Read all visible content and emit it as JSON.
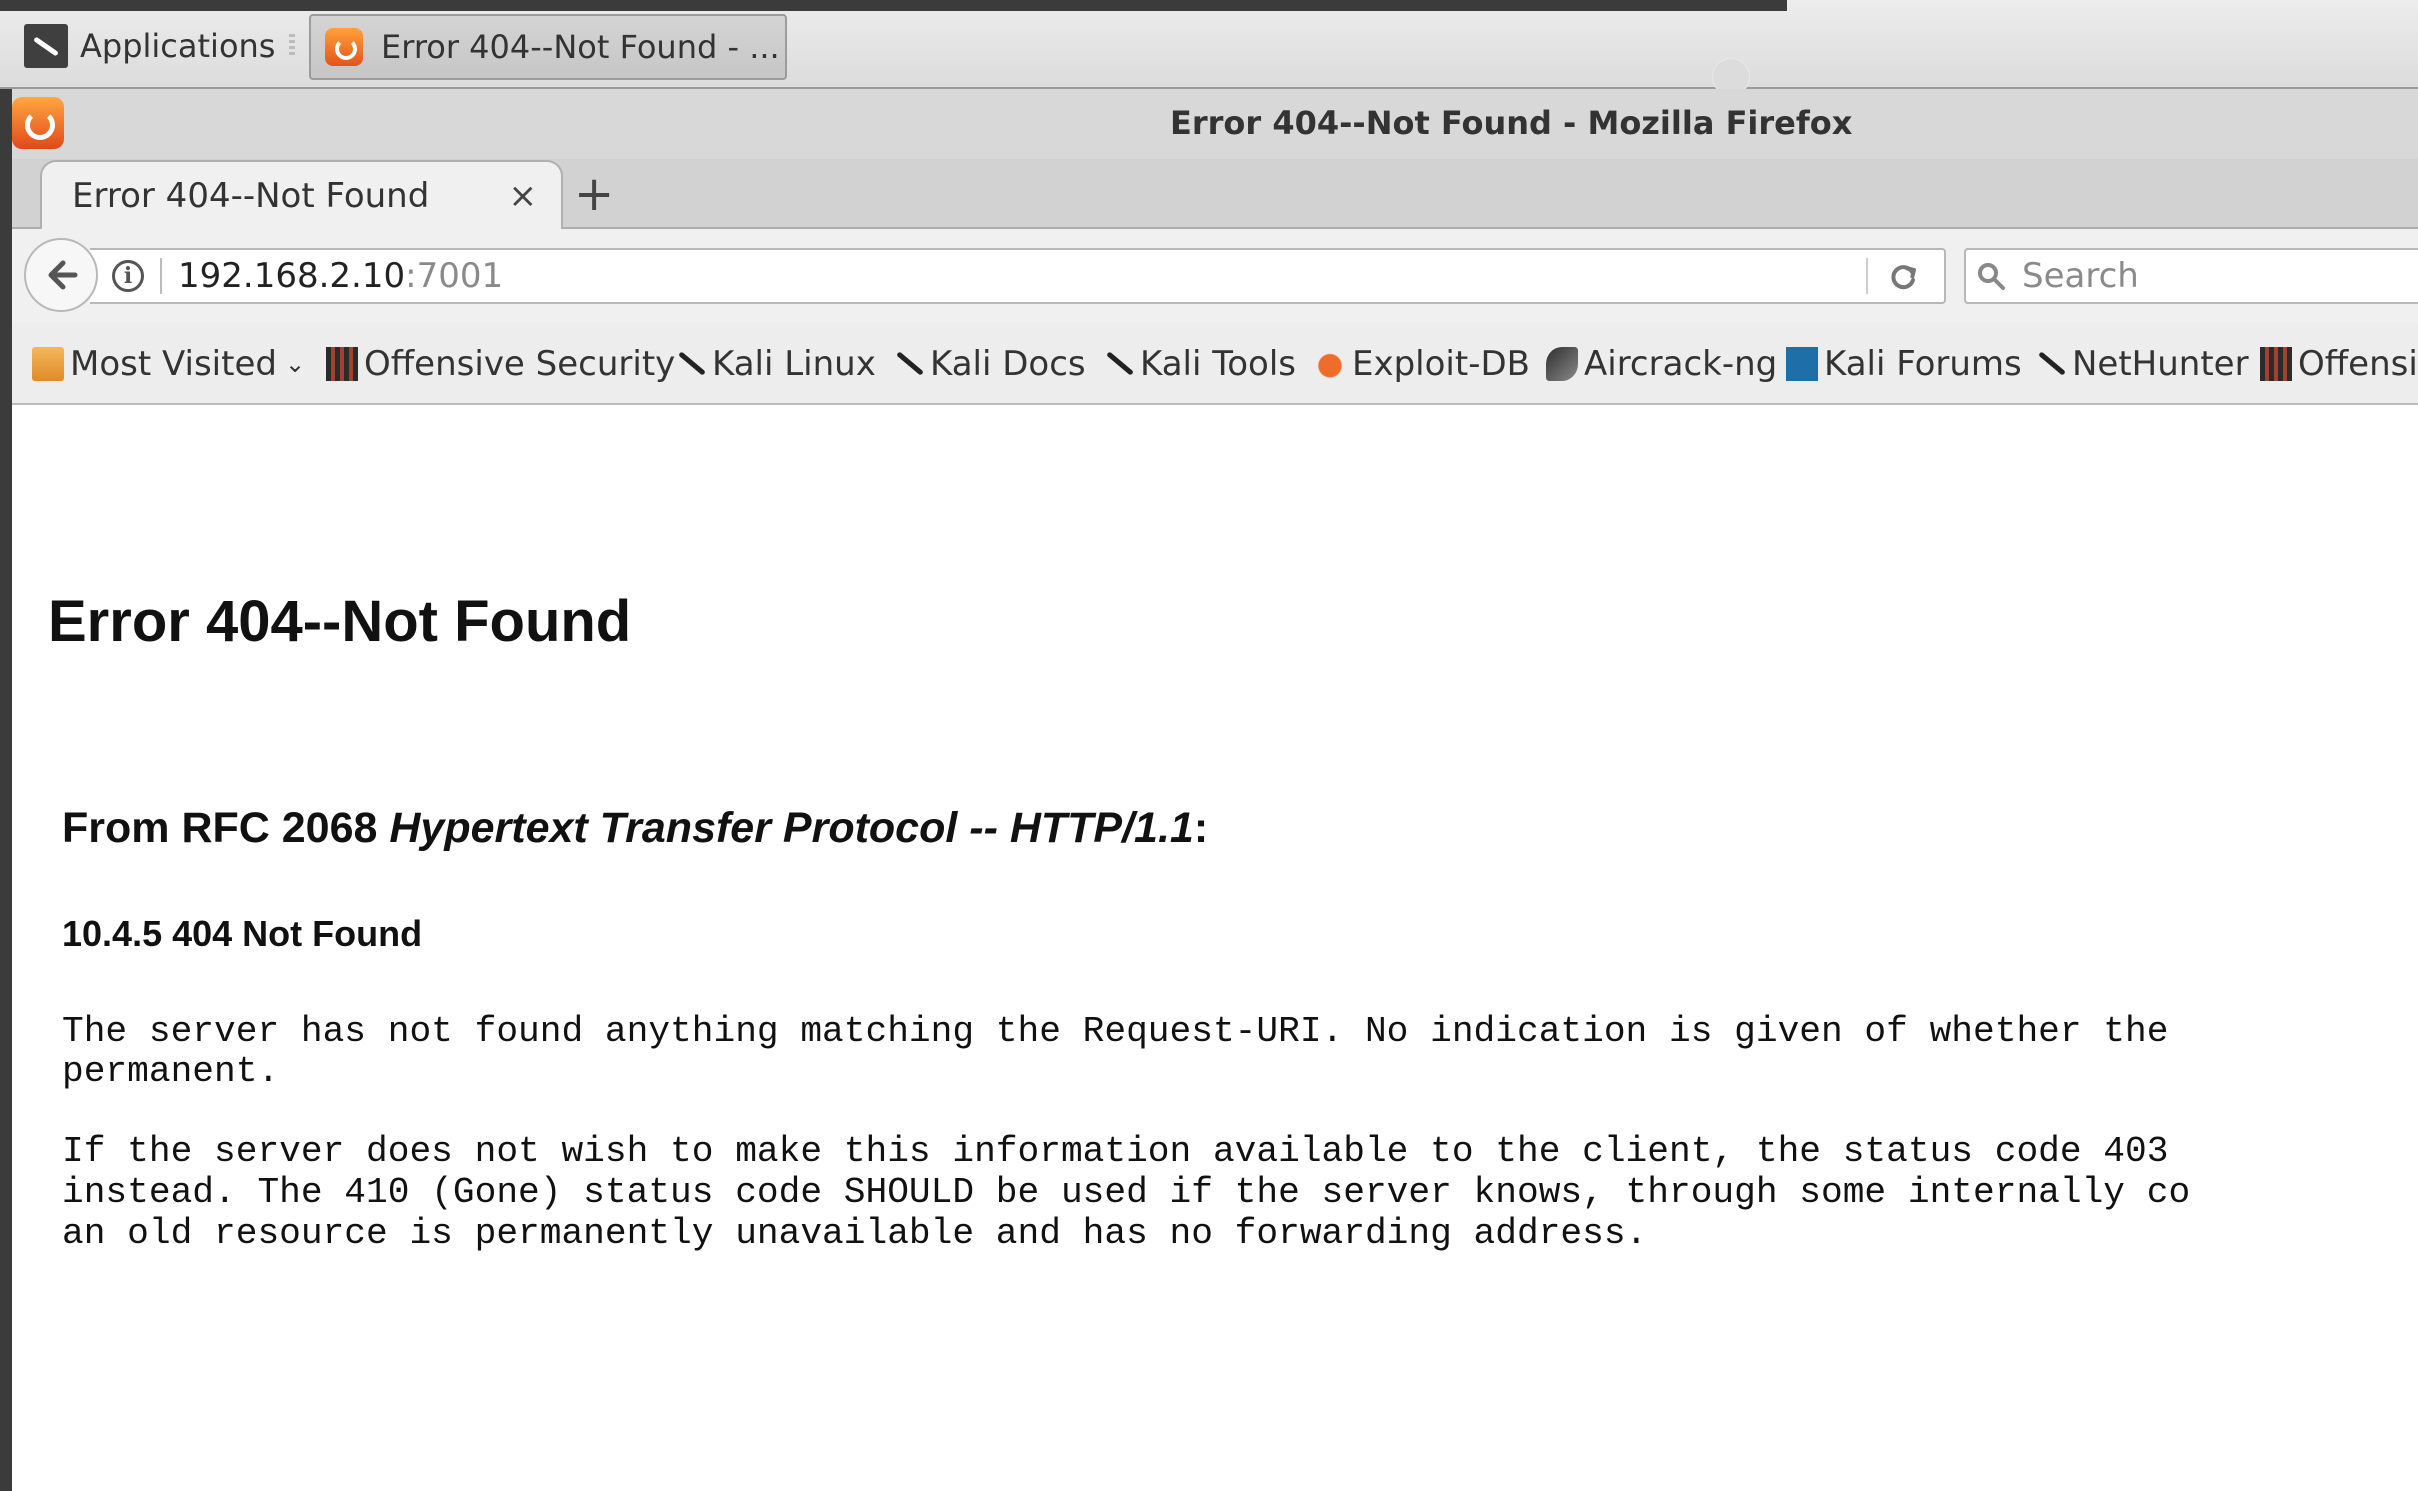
{
  "taskbar": {
    "applications_label": "Applications",
    "task_title": "Error 404--Not Found - ..."
  },
  "window": {
    "title": "Error 404--Not Found - Mozilla Firefox"
  },
  "tabs": [
    {
      "label": "Error 404--Not Found",
      "active": true
    }
  ],
  "navbar": {
    "url_host": "192.168.2.10",
    "url_port": ":7001",
    "search_placeholder": "Search"
  },
  "bookmarks": [
    {
      "label": "Most Visited",
      "icon": "folder-icon"
    },
    {
      "label": "Offensive Security",
      "icon": "offsec-icon"
    },
    {
      "label": "Kali Linux",
      "icon": "kali-dragon-icon"
    },
    {
      "label": "Kali Docs",
      "icon": "kali-dragon-icon"
    },
    {
      "label": "Kali Tools",
      "icon": "kali-dragon-icon"
    },
    {
      "label": "Exploit-DB",
      "icon": "exploit-db-icon"
    },
    {
      "label": "Aircrack-ng",
      "icon": "aircrack-icon"
    },
    {
      "label": "Kali Forums",
      "icon": "kali-forums-icon"
    },
    {
      "label": "NetHunter",
      "icon": "kali-dragon-icon"
    },
    {
      "label": "Offensi",
      "icon": "offsec-icon"
    }
  ],
  "page": {
    "heading": "Error 404--Not Found",
    "from_prefix": "From RFC 2068 ",
    "from_italic": "Hypertext Transfer Protocol -- HTTP/1.1",
    "from_suffix": ":",
    "section_title": "10.4.5 404 Not Found",
    "para1_lines": [
      "The server has not found anything matching the Request-URI. No indication is given of whether the",
      "permanent."
    ],
    "para2_lines": [
      "If the server does not wish to make this information available to the client, the status code 403",
      "instead. The 410 (Gone) status code SHOULD be used if the server knows, through some internally co",
      "an old resource is permanently unavailable and has no forwarding address."
    ]
  }
}
